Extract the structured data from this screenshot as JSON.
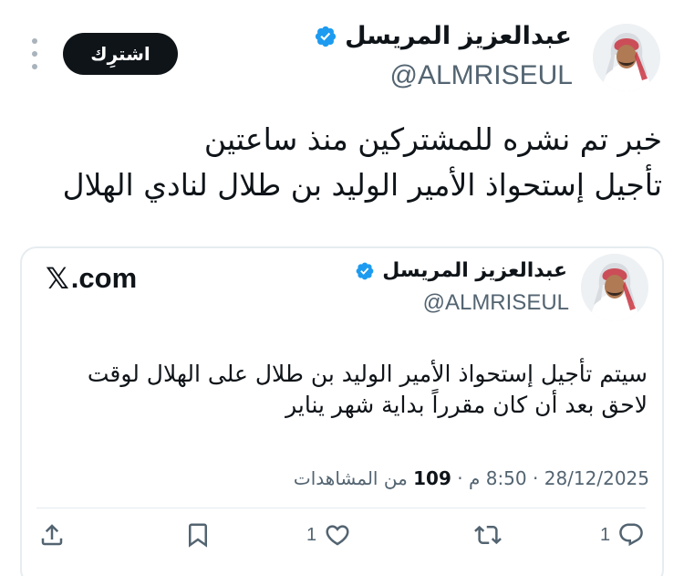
{
  "tweet": {
    "author_name": "عبدالعزيز المريسل",
    "author_handle": "@ALMRISEUL",
    "subscribe_label": "اشترِك",
    "text_lines": [
      "خبر تم نشره للمشتركين منذ ساعتين",
      "تأجيل إستحواذ الأمير الوليد بن طلال لنادي الهلال"
    ]
  },
  "quoted": {
    "source": "X.com",
    "source_glyph": "𝕏",
    "source_suffix": ".com",
    "author_name": "عبدالعزيز المريسل",
    "author_handle": "@ALMRISEUL",
    "text_lines": [
      "سيتم تأجيل إستحواذ الأمير الوليد بن طلال على الهلال لوقت",
      "لاحق بعد أن كان مقرراً بداية شهر يناير"
    ],
    "date": "28/12/2025",
    "separator": "·",
    "time": "8:50 م",
    "views_count": "109",
    "views_label": "من المشاهدات"
  },
  "actions": {
    "reply_count": "1",
    "retweet_count": "",
    "like_count": "1",
    "bookmark_count": "",
    "share_count": ""
  },
  "colors": {
    "verified": "#1d9bf0",
    "text": "#0f1419",
    "muted": "#536471",
    "border": "#e6ecf0",
    "button": "#0f1419"
  },
  "icons": [
    "more-icon",
    "verified-icon",
    "reply-icon",
    "retweet-icon",
    "like-icon",
    "bookmark-icon",
    "share-icon"
  ]
}
